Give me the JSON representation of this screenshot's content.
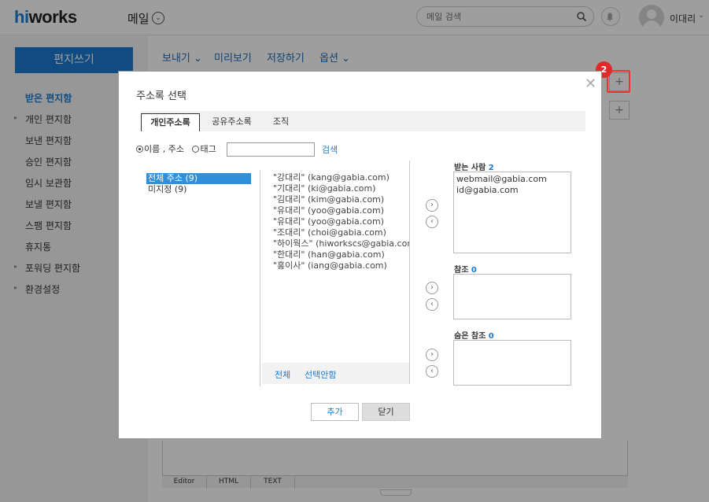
{
  "header": {
    "logo_hi": "hi",
    "logo_rest": "works",
    "app_title": "메일",
    "search_placeholder": "메일 검색",
    "user_name": "이대리"
  },
  "sidebar": {
    "compose": "편지쓰기",
    "items": [
      {
        "label": "받은 편지함"
      },
      {
        "label": "개인 편지함"
      },
      {
        "label": "보낸 편지함"
      },
      {
        "label": "승인 편지함"
      },
      {
        "label": "임시 보관함"
      },
      {
        "label": "보낼 편지함"
      },
      {
        "label": "스팸 편지함"
      },
      {
        "label": "휴지통"
      },
      {
        "label": "포워딩 편지함"
      },
      {
        "label": "환경설정"
      }
    ]
  },
  "toolbar": {
    "send": "보내기",
    "preview": "미리보기",
    "save": "저장하기",
    "options": "옵션"
  },
  "step_badge": "2",
  "editor_tabs": [
    "Editor",
    "HTML",
    "TEXT"
  ],
  "dialog": {
    "title": "주소록 선택",
    "tabs": [
      "개인주소록",
      "공유주소록",
      "조직"
    ],
    "radio_name_addr": "이름 , 주소",
    "radio_tag": "태그",
    "search_button": "검색",
    "groups": [
      {
        "label": "전체 주소 (9)"
      },
      {
        "label": "미지정 (9)"
      }
    ],
    "contacts": [
      "\"강대리\" (kang@gabia.com)",
      "\"기대리\" (ki@gabia.com)",
      "\"김대리\" (kim@gabia.com)",
      "\"유대리\" (yoo@gabia.com)",
      "\"유대리\" (yoo@gabia.com)",
      "\"조대리\" (choi@gabia.com)",
      "\"하이웍스\" (hiworkscs@gabia.con",
      "\"한대리\" (han@gabia.com)",
      "\"홍이사\" (iang@gabia.com)"
    ],
    "select_all": "전체",
    "deselect": "선택안함",
    "to_label": "받는 사람",
    "to_count": "2",
    "to_entries": [
      "webmail@gabia.com",
      "id@gabia.com"
    ],
    "cc_label": "참조",
    "cc_count": "0",
    "bcc_label": "숨은 참조",
    "bcc_count": "0",
    "add_button": "추가",
    "close_button": "닫기"
  }
}
